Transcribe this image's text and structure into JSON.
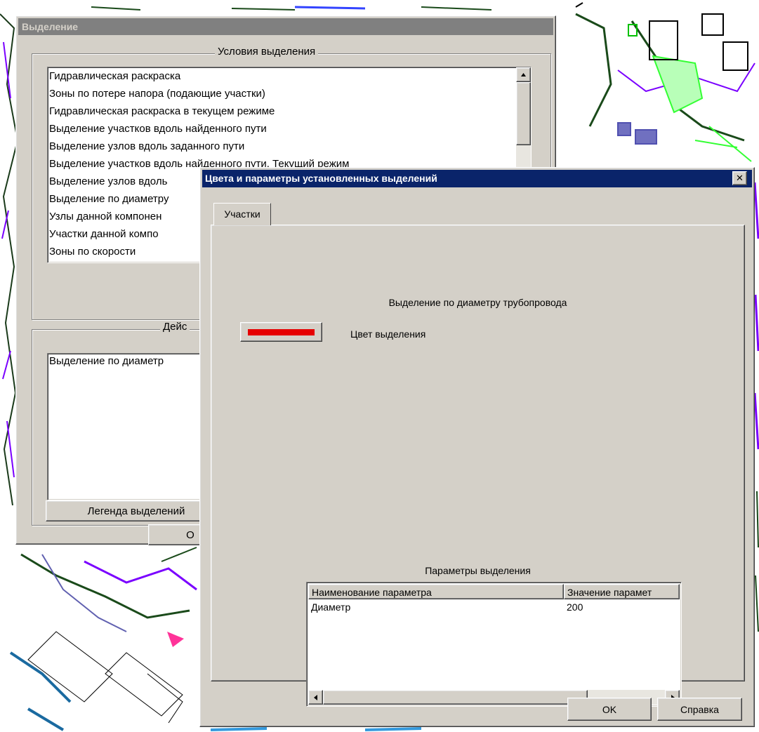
{
  "back_dialog": {
    "title": "Выделение",
    "conditions_legend": "Условия выделения",
    "conditions": [
      "Гидравлическая раскраска",
      "Зоны по потере напора (подающие участки)",
      "Гидравлическая раскраска в текущем режиме",
      "Выделение участков вдоль найденного пути",
      "Выделение узлов вдоль заданного пути",
      "Выделение участков вдоль найденного пути. Текущий режим",
      "Выделение узлов вдоль",
      "Выделение по диаметру",
      "Узлы данной компонен",
      "Участки данной компо",
      "Зоны по скорости"
    ],
    "actions_legend": "Дейс",
    "actions_list_value": "Выделение по диаметр",
    "legend_button": "Легенда выделений",
    "ok_button": "О"
  },
  "front_dialog": {
    "title": "Цвета и параметры установленных выделений",
    "close_label": "✕",
    "tab_label": "Участки",
    "selection_title": "Выделение по диаметру трубопровода",
    "color_label": "Цвет выделения",
    "highlight_color": "#e60000",
    "params_title": "Параметры выделения",
    "params_table": {
      "headers": [
        "Наименование параметра",
        "Значение парамет"
      ],
      "rows": [
        [
          "Диаметр",
          "200"
        ]
      ]
    },
    "ok_button": "OK",
    "help_button": "Справка"
  }
}
